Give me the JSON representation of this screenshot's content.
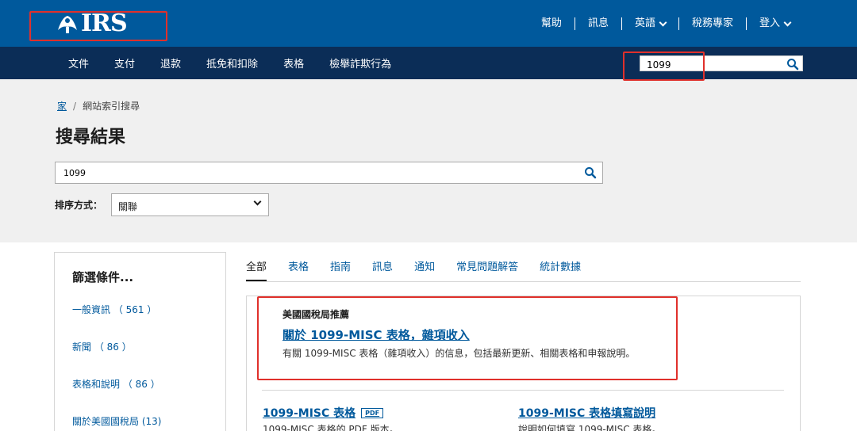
{
  "header": {
    "logo_text": "IRS",
    "links": [
      {
        "label": "幫助",
        "dropdown": false
      },
      {
        "label": "訊息",
        "dropdown": false
      },
      {
        "label": "英語",
        "dropdown": true
      },
      {
        "label": "稅務專家",
        "dropdown": false
      },
      {
        "label": "登入",
        "dropdown": true
      }
    ]
  },
  "nav": {
    "items": [
      "文件",
      "支付",
      "退款",
      "抵免和扣除",
      "表格",
      "檢舉詐欺行為"
    ],
    "search_value": "1099"
  },
  "breadcrumb": {
    "home": "家",
    "current": "網站索引搜尋"
  },
  "page_title": "搜尋結果",
  "main_search": {
    "value": "1099"
  },
  "sort": {
    "label": "排序方式：",
    "selected": "關聯"
  },
  "filters": {
    "title": "篩選條件...",
    "items": [
      {
        "label": "一般資訊 （ 561 ）"
      },
      {
        "label": "新聞 （ 86 ）"
      },
      {
        "label": "表格和說明 （ 86 ）"
      },
      {
        "label": "關於美國國稅局 (13)"
      }
    ]
  },
  "tabs": [
    "全部",
    "表格",
    "指南",
    "訊息",
    "通知",
    "常見問題解答",
    "統計數據"
  ],
  "recommended": {
    "label": "美國國稅局推薦",
    "link": "關於 1099-MISC 表格，雜項收入",
    "description": "有關 1099-MISC 表格（雜項收入）的信息，包括最新更新、相關表格和申報說明。"
  },
  "results": [
    {
      "title": "1099-MISC 表格",
      "badge": "PDF",
      "description": "1099-MISC 表格的 PDF 版本。"
    },
    {
      "title": "1099-MISC 表格填寫說明",
      "badge": "",
      "description": "說明如何填寫 1099-MISC 表格。"
    }
  ],
  "colors": {
    "header_blue": "#00599c",
    "nav_navy": "#0b2d57",
    "link_blue": "#00599c",
    "annotation_red": "#e0302b"
  }
}
